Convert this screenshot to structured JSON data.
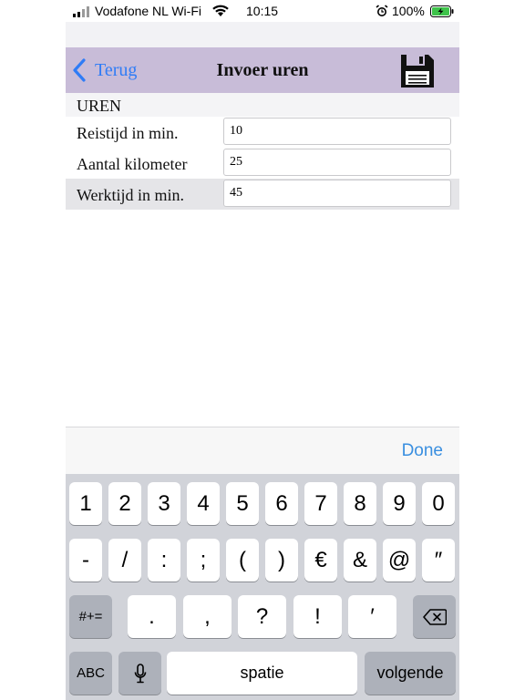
{
  "status_bar": {
    "carrier": "Vodafone NL Wi-Fi",
    "time": "10:15",
    "battery": "100%"
  },
  "nav": {
    "back_label": "Terug",
    "title": "Invoer uren"
  },
  "form": {
    "section": "UREN",
    "rows": [
      {
        "label": "Reistijd in min.",
        "value": "10"
      },
      {
        "label": "Aantal kilometer",
        "value": "25"
      },
      {
        "label": "Werktijd in min.",
        "value": "45"
      }
    ]
  },
  "accessory": {
    "done": "Done"
  },
  "keyboard": {
    "row1": [
      "1",
      "2",
      "3",
      "4",
      "5",
      "6",
      "7",
      "8",
      "9",
      "0"
    ],
    "row2": [
      "-",
      "/",
      ":",
      ";",
      "(",
      ")",
      "€",
      "&",
      "@",
      "″"
    ],
    "row3": [
      ".",
      ",",
      "?",
      "!",
      "′"
    ],
    "more_symbols": "#+=",
    "abc": "ABC",
    "space": "spatie",
    "return": "volgende"
  },
  "colors": {
    "nav_bg": "#c8bcd8",
    "link_blue": "#2f7cf6",
    "done_blue": "#3a8fe0",
    "keyboard_bg": "#d1d3d9"
  }
}
